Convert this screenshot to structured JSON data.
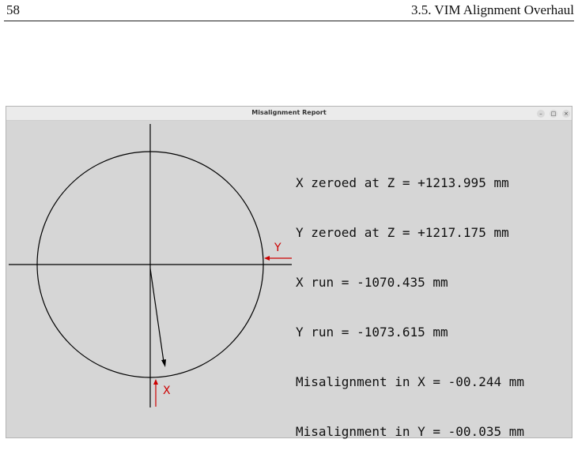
{
  "page": {
    "number": "58",
    "section": "3.5.  VIM Alignment Overhaul"
  },
  "window": {
    "title": "Misalignment Report",
    "controls": {
      "minimize": "–",
      "maximize": "□",
      "close": "×"
    }
  },
  "readout": {
    "lines": [
      "X zeroed at Z = +1213.995 mm",
      "Y zeroed at Z = +1217.175 mm",
      "X run = -1070.435 mm",
      "Y run = -1073.615 mm",
      "Misalignment in X = -00.244 mm",
      "Misalignment in Y = -00.035 mm"
    ]
  },
  "plot": {
    "x_marker_label": "X",
    "y_marker_label": "Y",
    "marker_color": "#cc0000",
    "line_color": "#000000"
  }
}
